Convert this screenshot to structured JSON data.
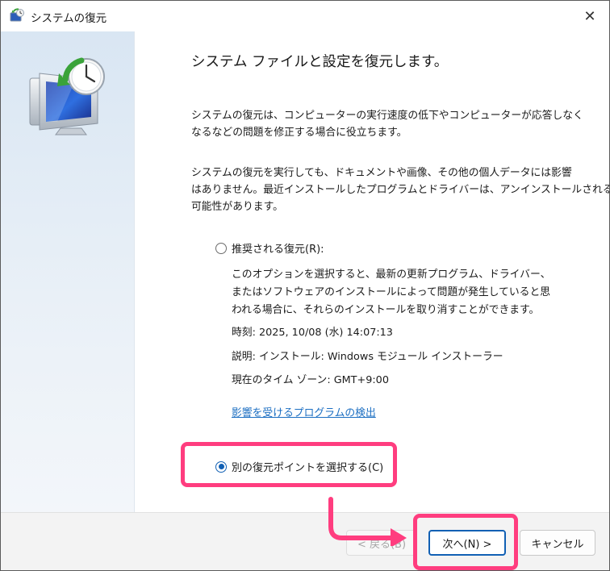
{
  "window": {
    "title": "システムの復元",
    "close_glyph": "✕"
  },
  "content": {
    "heading": "システム ファイルと設定を復元します。",
    "paragraph1": [
      "システムの復元は、コンピューターの実行速度の低下やコンピューターが応答しなく",
      "なるなどの問題を修正する場合に役立ちます。"
    ],
    "paragraph2": [
      "システムの復元を実行しても、ドキュメントや画像、その他の個人データには影響",
      "はありません。最近インストールしたプログラムとドライバーは、アンインストールされる",
      "可能性があります。"
    ],
    "recommended": {
      "label": "推奨される復元(R):",
      "selected": false,
      "description": [
        "このオプションを選択すると、最新の更新プログラム、ドライバー、",
        "またはソフトウェアのインストールによって問題が発生していると思",
        "われる場合に、それらのインストールを取り消すことができます。"
      ],
      "time": "時刻: 2025, 10/08 (水) 14:07:13",
      "description_line": "説明: インストール: Windows モジュール インストーラー",
      "timezone": "現在のタイム ゾーン: GMT+9:00",
      "link": "影響を受けるプログラムの検出"
    },
    "other": {
      "label": "別の復元ポイントを選択する(C)",
      "selected": true
    }
  },
  "footer": {
    "back_label": "< 戻る(B)",
    "next_label": "次へ(N) >",
    "cancel_label": "キャンセル"
  },
  "colors": {
    "accent": "#1160b4",
    "highlight": "#ff3d7f",
    "link": "#1b6ec2"
  },
  "icons": {
    "app": "system-restore-icon",
    "hero": "system-restore-monitor-icon",
    "close": "close-icon"
  }
}
